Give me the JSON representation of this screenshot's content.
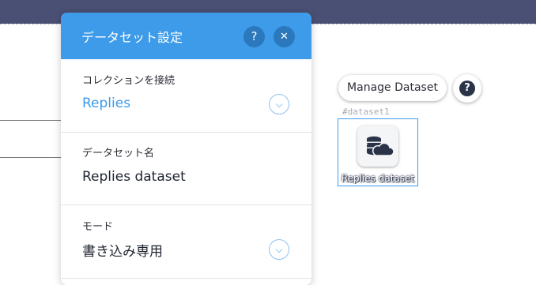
{
  "panel": {
    "title": "データセット設定",
    "help_label": "?",
    "close_label": "✕",
    "collection": {
      "label": "コレクションを接続",
      "value": "Replies"
    },
    "dataset_name": {
      "label": "データセット名",
      "value": "Replies dataset"
    },
    "mode": {
      "label": "モード",
      "value": "書き込み専用"
    },
    "chevron": "⌵"
  },
  "canvas": {
    "manage_button": "Manage Dataset",
    "help_glyph": "?",
    "dataset_id": "#dataset1",
    "dataset_label": "Replies dataset"
  },
  "colors": {
    "topbar": "#4a4f74",
    "accent": "#3d9be9"
  }
}
